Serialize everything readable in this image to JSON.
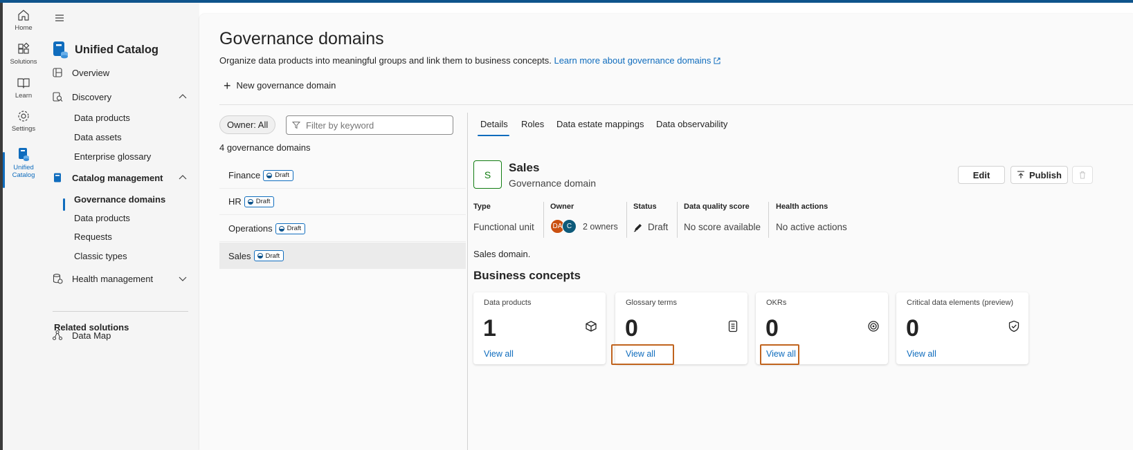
{
  "colors": {
    "accent": "#0f6cbd",
    "topbar": "#0f548c",
    "domain_avatar": "#107c10",
    "highlight": "#c0631d",
    "owner_da": "#ca5010",
    "owner_c": "#0e5a7a"
  },
  "rail": {
    "items": [
      {
        "label": "Home",
        "icon": "home-icon"
      },
      {
        "label": "Solutions",
        "icon": "solutions-icon"
      },
      {
        "label": "Learn",
        "icon": "book-icon"
      },
      {
        "label": "Settings",
        "icon": "gear-icon"
      },
      {
        "label": "Unified Catalog",
        "icon": "unified-catalog-icon",
        "active": true
      }
    ]
  },
  "nav": {
    "title": "Unified Catalog",
    "overview": "Overview",
    "discovery": {
      "label": "Discovery",
      "items": [
        "Data products",
        "Data assets",
        "Enterprise glossary"
      ]
    },
    "catalog_management": {
      "label": "Catalog management",
      "items": [
        "Governance domains",
        "Data products",
        "Requests",
        "Classic types"
      ],
      "selected": "Governance domains"
    },
    "health_management": "Health management",
    "related_title": "Related solutions",
    "data_map": "Data Map"
  },
  "page": {
    "title": "Governance domains",
    "description": "Organize data products into meaningful groups and link them to business concepts.",
    "learn_more": "Learn more about governance domains",
    "new_button": "New governance domain",
    "owner_filter": "Owner: All",
    "filter_placeholder": "Filter by keyword",
    "count_text": "4 governance domains"
  },
  "domains": [
    {
      "name": "Finance",
      "status": "Draft"
    },
    {
      "name": "HR",
      "status": "Draft"
    },
    {
      "name": "Operations",
      "status": "Draft"
    },
    {
      "name": "Sales",
      "status": "Draft",
      "selected": true
    }
  ],
  "tabs": [
    "Details",
    "Roles",
    "Data estate mappings",
    "Data observability"
  ],
  "active_tab": "Details",
  "detail": {
    "initial": "S",
    "name": "Sales",
    "subtitle": "Governance domain",
    "edit_label": "Edit",
    "publish_label": "Publish",
    "meta": {
      "type_label": "Type",
      "type_value": "Functional unit",
      "owner_label": "Owner",
      "owner_initials": [
        "DA",
        "C"
      ],
      "owner_value": "2 owners",
      "status_label": "Status",
      "status_value": "Draft",
      "dq_label": "Data quality score",
      "dq_value": "No score available",
      "health_label": "Health actions",
      "health_value": "No active actions"
    },
    "description": "Sales domain.",
    "business_concepts_title": "Business concepts",
    "cards": [
      {
        "label": "Data products",
        "value": "1",
        "link": "View all",
        "icon": "cube-icon"
      },
      {
        "label": "Glossary terms",
        "value": "0",
        "link": "View all",
        "icon": "document-icon"
      },
      {
        "label": "OKRs",
        "value": "0",
        "link": "View all",
        "icon": "target-icon"
      },
      {
        "label": "Critical data elements (preview)",
        "value": "0",
        "link": "View all",
        "icon": "shield-check-icon"
      }
    ]
  }
}
